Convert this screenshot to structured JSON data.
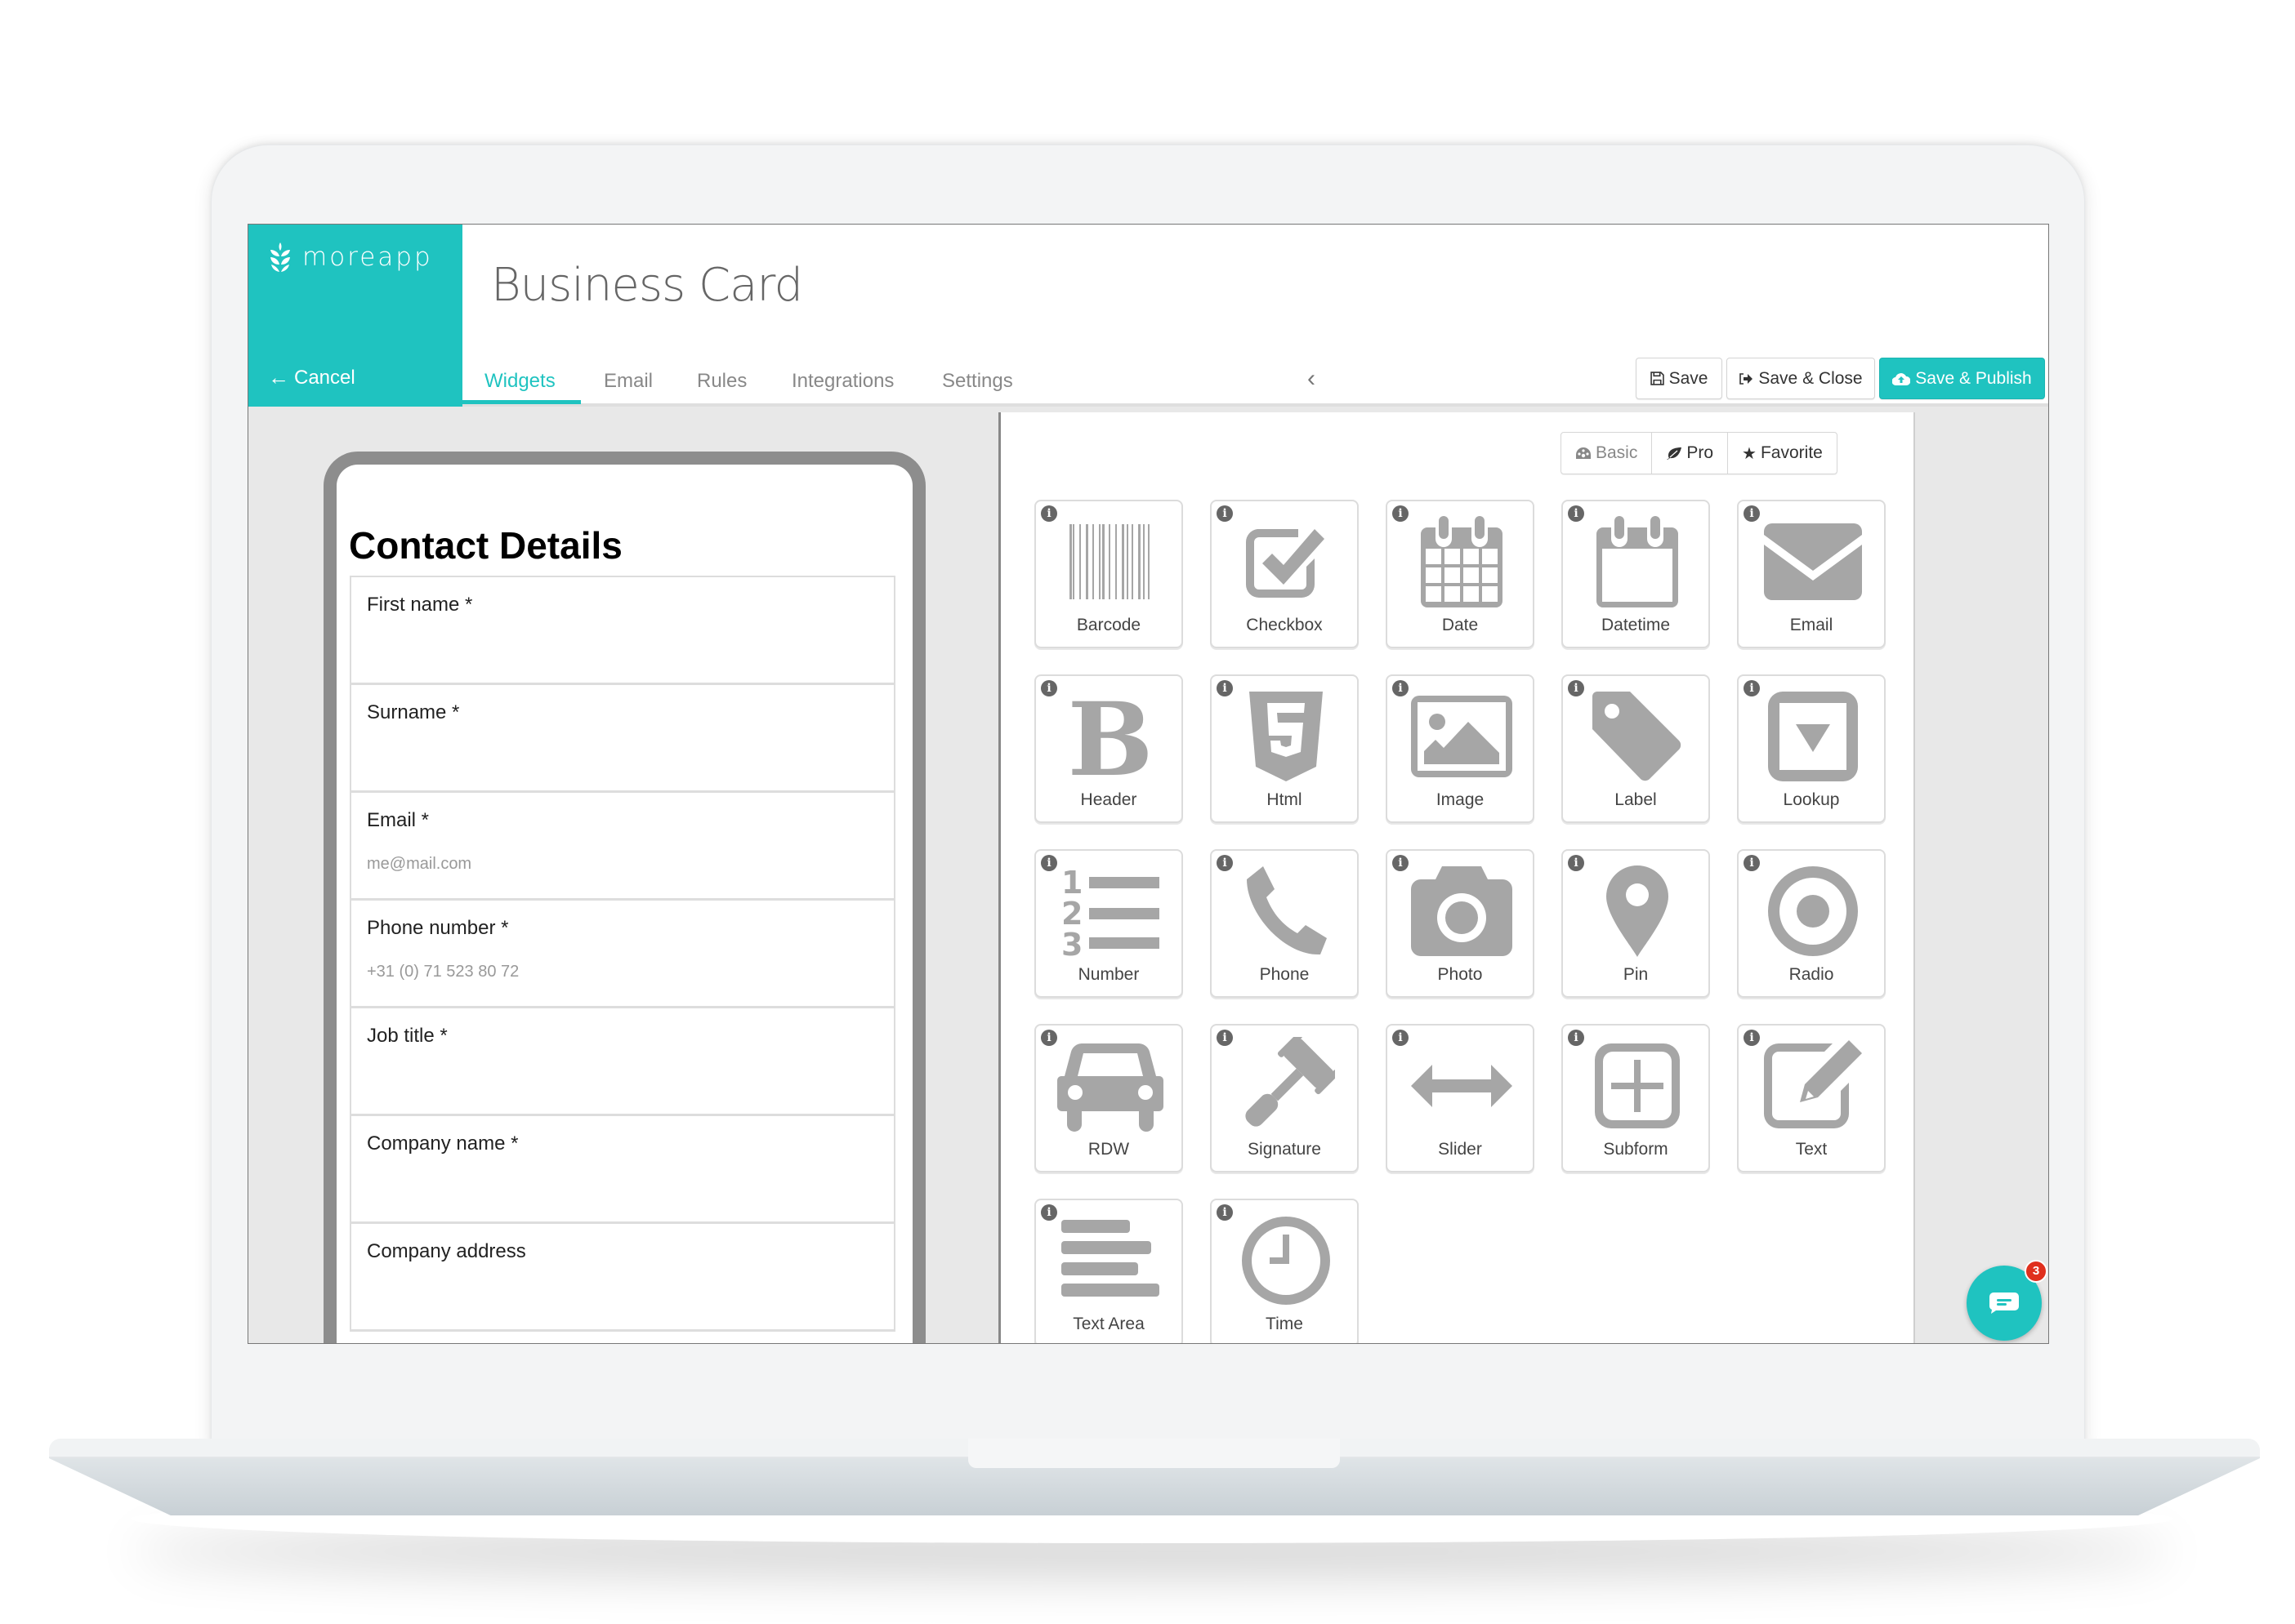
{
  "app": {
    "brand": "moreapp",
    "cancel_label": "Cancel",
    "title": "Business Card",
    "accent_color": "#1fc3c0"
  },
  "tabs": [
    {
      "label": "Widgets",
      "active": true
    },
    {
      "label": "Email",
      "active": false
    },
    {
      "label": "Rules",
      "active": false
    },
    {
      "label": "Integrations",
      "active": false
    },
    {
      "label": "Settings",
      "active": false
    }
  ],
  "toolbar": {
    "save_label": "Save",
    "save_close_label": "Save & Close",
    "save_publish_label": "Save & Publish"
  },
  "form": {
    "title": "Contact Details",
    "fields": [
      {
        "label": "First name *",
        "placeholder": ""
      },
      {
        "label": "Surname *",
        "placeholder": ""
      },
      {
        "label": "Email *",
        "placeholder": "me@mail.com"
      },
      {
        "label": "Phone number *",
        "placeholder": "+31 (0) 71 523 80 72"
      },
      {
        "label": "Job title *",
        "placeholder": ""
      },
      {
        "label": "Company name *",
        "placeholder": ""
      },
      {
        "label": "Company address",
        "placeholder": ""
      }
    ]
  },
  "filters": [
    {
      "label": "Basic",
      "icon": "dashboard-icon"
    },
    {
      "label": "Pro",
      "icon": "leaf-icon"
    },
    {
      "label": "Favorite",
      "icon": "star-icon"
    }
  ],
  "widgets": [
    {
      "label": "Barcode",
      "icon": "barcode-icon"
    },
    {
      "label": "Checkbox",
      "icon": "checkbox-icon"
    },
    {
      "label": "Date",
      "icon": "calendar-icon"
    },
    {
      "label": "Datetime",
      "icon": "calendar-blank-icon"
    },
    {
      "label": "Email",
      "icon": "envelope-icon"
    },
    {
      "label": "Header",
      "icon": "bold-icon"
    },
    {
      "label": "Html",
      "icon": "html5-icon"
    },
    {
      "label": "Image",
      "icon": "image-icon"
    },
    {
      "label": "Label",
      "icon": "tag-icon"
    },
    {
      "label": "Lookup",
      "icon": "dropdown-icon"
    },
    {
      "label": "Number",
      "icon": "ordered-list-icon"
    },
    {
      "label": "Phone",
      "icon": "phone-icon"
    },
    {
      "label": "Photo",
      "icon": "camera-icon"
    },
    {
      "label": "Pin",
      "icon": "map-marker-icon"
    },
    {
      "label": "Radio",
      "icon": "radio-icon"
    },
    {
      "label": "RDW",
      "icon": "car-icon"
    },
    {
      "label": "Signature",
      "icon": "gavel-icon"
    },
    {
      "label": "Slider",
      "icon": "arrows-horizontal-icon"
    },
    {
      "label": "Subform",
      "icon": "plus-square-icon"
    },
    {
      "label": "Text",
      "icon": "edit-icon"
    },
    {
      "label": "Text Area",
      "icon": "align-left-icon"
    },
    {
      "label": "Time",
      "icon": "clock-icon"
    }
  ],
  "chat": {
    "badge_count": "3"
  }
}
